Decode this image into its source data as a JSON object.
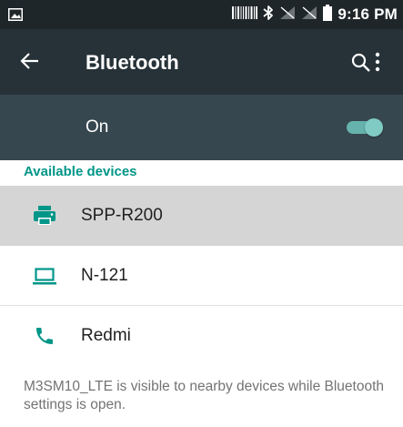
{
  "status_bar": {
    "time": "9:16 PM",
    "icons": [
      "image-icon",
      "barcode-icon",
      "bluetooth-icon",
      "no-signal-icon",
      "no-signal-icon",
      "battery-icon"
    ]
  },
  "app_bar": {
    "title": "Bluetooth",
    "icons": [
      "back-arrow-icon",
      "search-icon",
      "more-vert-icon"
    ]
  },
  "bluetooth_toggle": {
    "label": "On",
    "state": "on"
  },
  "available_devices": {
    "header": "Available devices",
    "items": [
      {
        "name": "SPP-R200",
        "icon": "printer-icon",
        "selected": true
      },
      {
        "name": "N-121",
        "icon": "laptop-icon",
        "selected": false
      },
      {
        "name": "Redmi",
        "icon": "phone-icon",
        "selected": false
      }
    ]
  },
  "footer_text": "M3SM10_LTE is visible to nearby devices while Bluetooth settings is open.",
  "colors": {
    "status_bar": "#1f262a",
    "app_bar": "#263238",
    "toggle_row": "#37474f",
    "accent": "#009688",
    "selected_row": "#d5d5d5"
  }
}
